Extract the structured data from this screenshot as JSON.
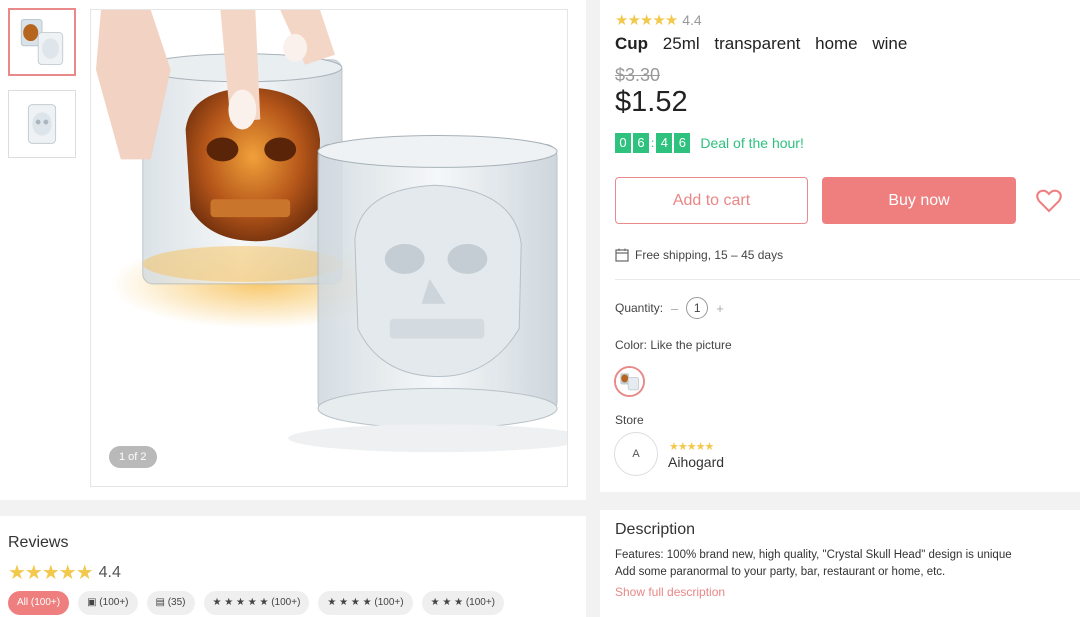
{
  "gallery": {
    "counter": "1 of 2",
    "thumbnails": [
      "thumbnail-1",
      "thumbnail-2"
    ]
  },
  "product": {
    "rating_stars": "★★★★★",
    "rating_value": "4.4",
    "title_words": [
      "Cup",
      "25ml",
      "transparent",
      "home",
      "wine"
    ],
    "old_price": "$3.30",
    "price": "$1.52",
    "timer_digits": [
      "0",
      "6",
      "4",
      "6"
    ],
    "deal_text": "Deal of the hour!",
    "add_to_cart": "Add to cart",
    "buy_now": "Buy now",
    "shipping": "Free shipping, 15 – 45 days",
    "quantity_label": "Quantity:",
    "quantity_minus": "–",
    "quantity_value": "1",
    "quantity_plus": "+",
    "color_label": "Color: Like the picture",
    "store_label": "Store",
    "store_avatar": "A",
    "store_stars": "★★★★★",
    "store_name": "Aihogard"
  },
  "reviews": {
    "title": "Reviews",
    "stars": "★★★★★",
    "value": "4.4",
    "chips": [
      "All (100+)",
      "▣ (100+)",
      "▤ (35)",
      "★ ★ ★ ★ ★ (100+)",
      "★ ★ ★ ★ (100+)",
      "★ ★ ★ (100+)"
    ]
  },
  "description": {
    "title": "Description",
    "line1": "Features: 100% brand new, high quality, \"Crystal Skull Head\" design is unique",
    "line2": "Add some paranormal to your party, bar, restaurant or home, etc.",
    "show_more": "Show full description"
  },
  "colors": {
    "accent": "#ef7f7f",
    "green": "#2ec27e",
    "star": "#f2c94c"
  }
}
